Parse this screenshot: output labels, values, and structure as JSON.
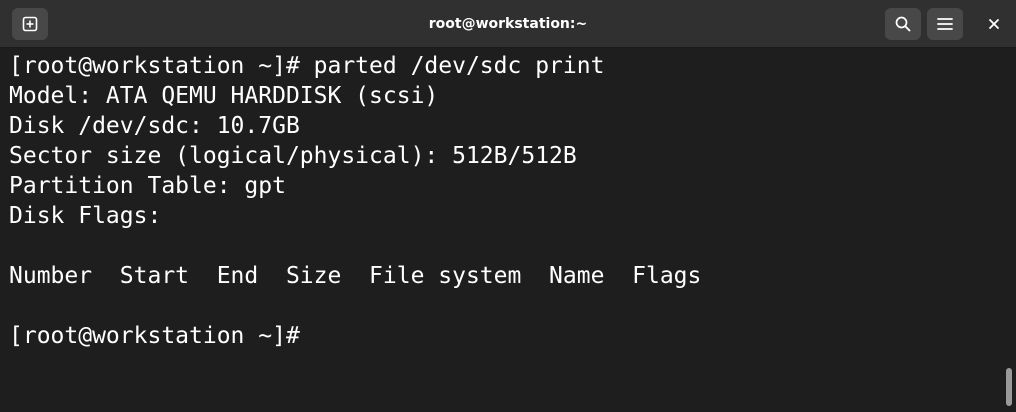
{
  "window": {
    "title": "root@workstation:~",
    "buttons": {
      "new_tab_icon": "new-tab-icon",
      "search_icon": "search-icon",
      "menu_icon": "hamburger-menu-icon",
      "close_icon": "close-icon"
    }
  },
  "terminal": {
    "lines": [
      "[root@workstation ~]# parted /dev/sdc print",
      "Model: ATA QEMU HARDDISK (scsi)",
      "Disk /dev/sdc: 10.7GB",
      "Sector size (logical/physical): 512B/512B",
      "Partition Table: gpt",
      "Disk Flags:",
      "",
      "Number  Start  End  Size  File system  Name  Flags",
      "",
      "[root@workstation ~]#"
    ]
  },
  "colors": {
    "background": "#1e1e1e",
    "titlebar": "#303030",
    "text": "#ffffff",
    "button": "#484848"
  }
}
